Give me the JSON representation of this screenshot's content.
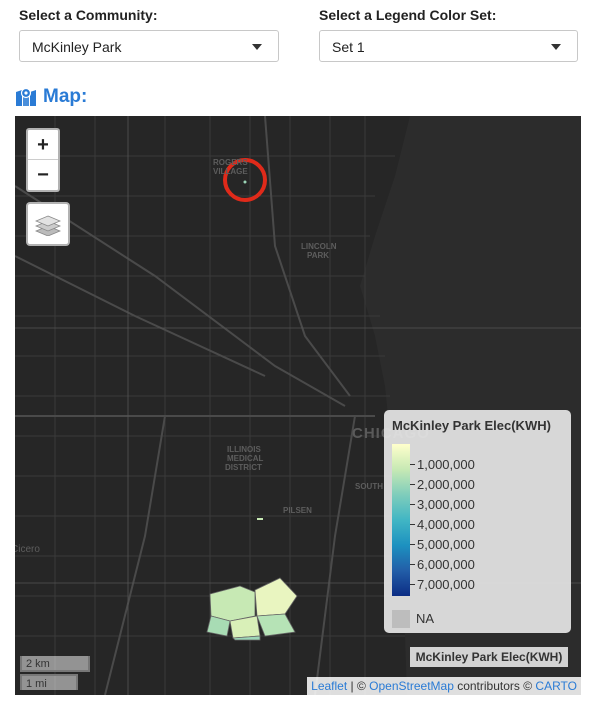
{
  "filters": {
    "community_label": "Select a Community:",
    "community_value": "McKinley Park",
    "colorset_label": "Select a Legend Color Set:",
    "colorset_value": "Set 1"
  },
  "map_heading": "Map:",
  "map": {
    "zoom_in": "+",
    "zoom_out": "−",
    "place_labels": {
      "rogers_village_1": "ROGERS",
      "rogers_village_2": "VILLAGE",
      "lincoln_park_1": "LINCOLN",
      "lincoln_park_2": "PARK",
      "chicago": "CHICAGO",
      "illinois_medical_1": "ILLINOIS",
      "illinois_medical_2": "MEDICAL",
      "illinois_medical_3": "DISTRICT",
      "pilsen": "PILSEN",
      "south": "SOUTH",
      "cicero": "Cicero"
    },
    "legend": {
      "title": "McKinley Park Elec(KWH)",
      "ticks": [
        "1,000,000",
        "2,000,000",
        "3,000,000",
        "4,000,000",
        "5,000,000",
        "6,000,000",
        "7,000,000"
      ],
      "na_label": "NA"
    },
    "layer_control_label": "McKinley Park Elec(KWH)",
    "scale": {
      "km": "2 km",
      "mi": "1 mi"
    },
    "attribution": {
      "leaflet": "Leaflet",
      "sep": " | © ",
      "osm": "OpenStreetMap",
      "contrib": " contributors © ",
      "carto": "CARTO"
    }
  }
}
